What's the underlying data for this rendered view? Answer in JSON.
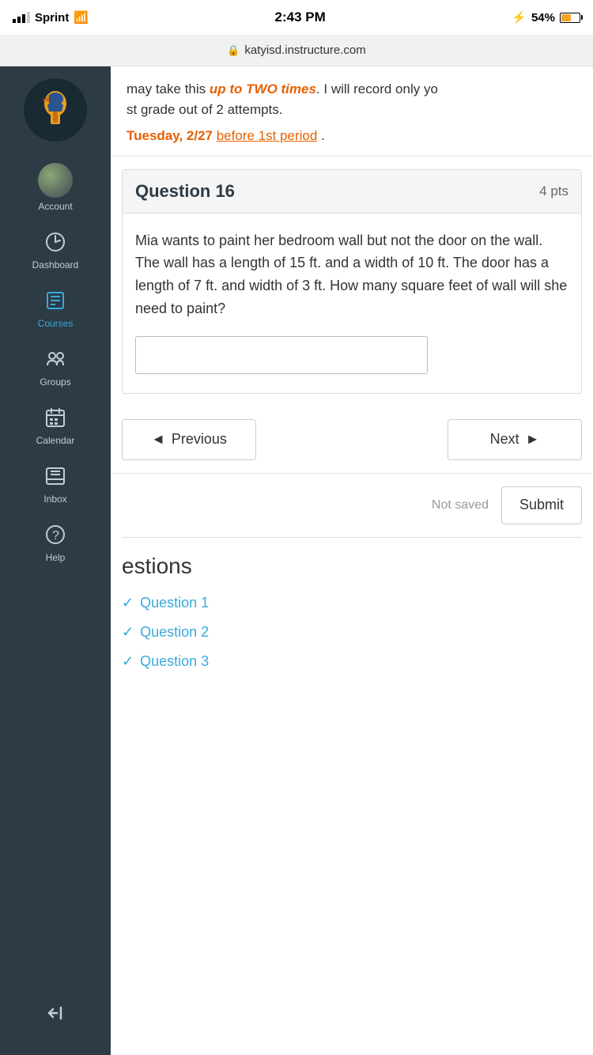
{
  "statusBar": {
    "carrier": "Sprint",
    "time": "2:43 PM",
    "battery": "54%",
    "wifi": true,
    "bluetooth": true
  },
  "urlBar": {
    "url": "katyisd.instructure.com",
    "secure": true
  },
  "sidebar": {
    "logoAlt": "Katy ISD Spartan logo",
    "items": [
      {
        "id": "account",
        "label": "Account",
        "icon": "👤",
        "active": false
      },
      {
        "id": "dashboard",
        "label": "Dashboard",
        "icon": "⏱",
        "active": false
      },
      {
        "id": "courses",
        "label": "Courses",
        "icon": "📋",
        "active": true
      },
      {
        "id": "groups",
        "label": "Groups",
        "icon": "👥",
        "active": false
      },
      {
        "id": "calendar",
        "label": "Calendar",
        "icon": "📅",
        "active": false
      },
      {
        "id": "inbox",
        "label": "Inbox",
        "icon": "📝",
        "active": false
      },
      {
        "id": "help",
        "label": "Help",
        "icon": "❓",
        "active": false
      }
    ],
    "collapseIcon": "⊣"
  },
  "contentHeader": {
    "line1_prefix": "may take this ",
    "line1_bold": "up to TWO times",
    "line1_suffix": ". I will record only yo",
    "line2": "st grade out of 2 attempts.",
    "line3_date": "Tuesday, 2/27",
    "line3_link": "before 1st period",
    "line3_suffix": "."
  },
  "question": {
    "number": "Question 16",
    "points": "4 pts",
    "text": "Mia wants to paint her bedroom wall but not the door on the wall. The wall has a length of 15 ft. and a width of 10 ft. The door has a length of 7 ft. and width of 3 ft. How many square feet of wall will she need to paint?",
    "answerPlaceholder": ""
  },
  "navigation": {
    "previousLabel": "◄ Previous",
    "nextLabel": "Next ►"
  },
  "saveBar": {
    "statusText": "Not saved",
    "submitLabel": "Submit"
  },
  "questionsSection": {
    "title": "estions",
    "items": [
      {
        "label": "Question 1",
        "checked": true
      },
      {
        "label": "Question 2",
        "checked": true
      },
      {
        "label": "Question 3",
        "checked": true
      }
    ]
  }
}
